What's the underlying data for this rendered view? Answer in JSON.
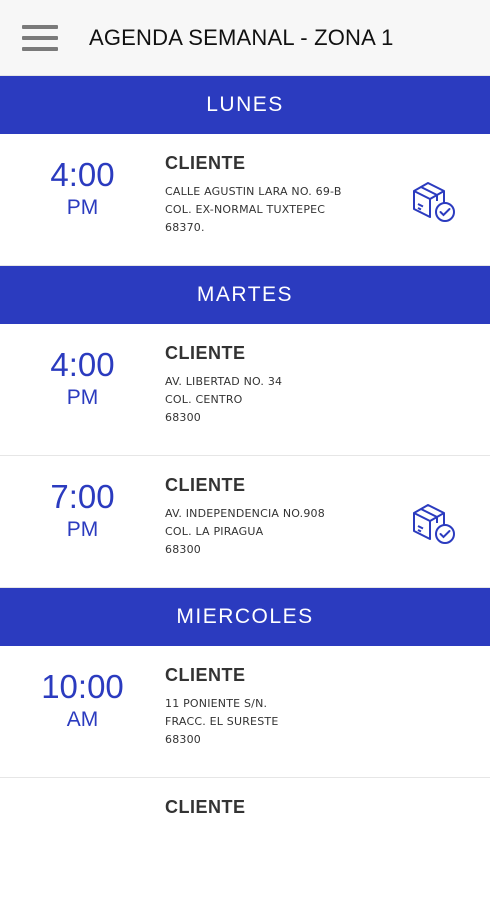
{
  "header": {
    "title": "AGENDA SEMANAL - ZONA 1",
    "menu_icon": "hamburger-menu-icon"
  },
  "colors": {
    "accent": "#2b3bbf",
    "header_bg": "#f7f7f7"
  },
  "days": [
    {
      "name": "LUNES",
      "appointments": [
        {
          "hour": "4:00",
          "ampm": "PM",
          "client": "CLIENTE",
          "address": [
            "CALLE AGUSTIN LARA NO. 69-B",
            "COL. EX-NORMAL TUXTEPEC",
            "68370."
          ],
          "icon": "package-delivered-icon"
        }
      ]
    },
    {
      "name": "MARTES",
      "appointments": [
        {
          "hour": "4:00",
          "ampm": "PM",
          "client": "CLIENTE",
          "address": [
            "AV. LIBERTAD NO. 34",
            "COL. CENTRO",
            "68300"
          ]
        },
        {
          "hour": "7:00",
          "ampm": "PM",
          "client": "CLIENTE",
          "address": [
            "AV. INDEPENDENCIA NO.908",
            "COL. LA PIRAGUA",
            "68300"
          ],
          "icon": "package-delivered-icon"
        }
      ]
    },
    {
      "name": "MIERCOLES",
      "appointments": [
        {
          "hour": "10:00",
          "ampm": "AM",
          "client": "CLIENTE",
          "address": [
            "11 PONIENTE S/N.",
            "FRACC. EL SURESTE",
            "68300"
          ]
        }
      ]
    }
  ],
  "partial_next": {
    "client": "CLIENTE"
  }
}
